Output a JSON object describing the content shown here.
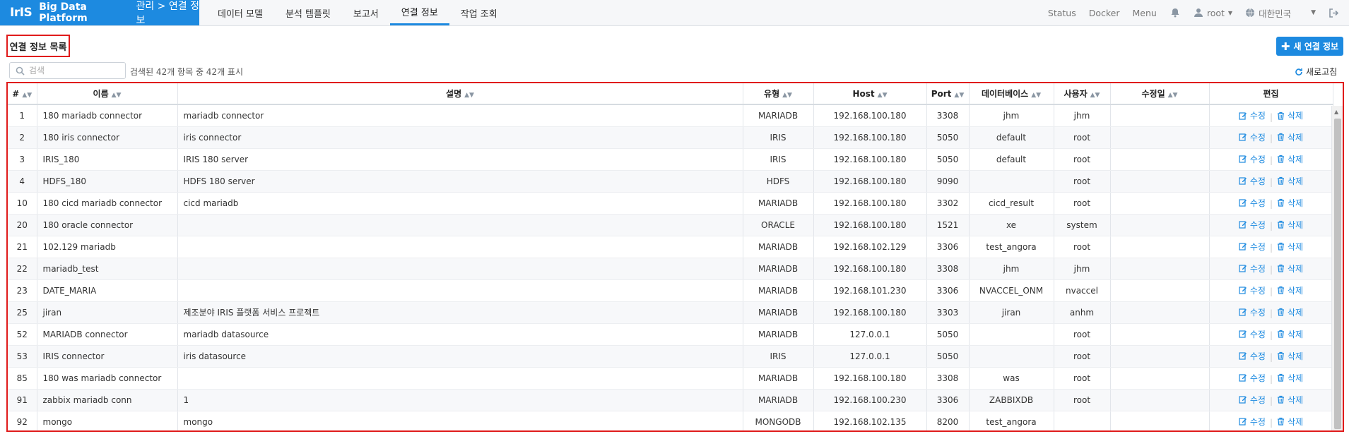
{
  "brand": {
    "logo": "IrIS",
    "name": "Big Data Platform",
    "breadcrumb": "관리 > 연결 정보",
    "color": "#1d8ae0"
  },
  "nav": {
    "items": [
      "데이터 모델",
      "분석 템플릿",
      "보고서",
      "연결 정보",
      "작업 조회"
    ],
    "active": "연결 정보"
  },
  "nav_right": {
    "status": "Status",
    "docker": "Docker",
    "menu": "Menu",
    "user": "root",
    "language": "대한민국"
  },
  "page": {
    "title": "연결 정보 목록",
    "new_button": "새 연결 정보",
    "search_placeholder": "검색",
    "count_text": "검색된 42개 항목 중 42개 표시",
    "refresh": "새로고침"
  },
  "table": {
    "columns": [
      "#",
      "이름",
      "설명",
      "유형",
      "Host",
      "Port",
      "데이터베이스",
      "사용자",
      "수정일",
      "편집"
    ],
    "edit_label": "수정",
    "delete_label": "삭제",
    "rows": [
      {
        "id": "1",
        "name": "180 mariadb connector",
        "desc": "mariadb connector",
        "type": "MARIADB",
        "host": "192.168.100.180",
        "port": "3308",
        "db": "jhm",
        "user": "jhm",
        "date": ""
      },
      {
        "id": "2",
        "name": "180 iris connector",
        "desc": "iris connector",
        "type": "IRIS",
        "host": "192.168.100.180",
        "port": "5050",
        "db": "default",
        "user": "root",
        "date": ""
      },
      {
        "id": "3",
        "name": "IRIS_180",
        "desc": "IRIS 180 server",
        "type": "IRIS",
        "host": "192.168.100.180",
        "port": "5050",
        "db": "default",
        "user": "root",
        "date": ""
      },
      {
        "id": "4",
        "name": "HDFS_180",
        "desc": "HDFS 180 server",
        "type": "HDFS",
        "host": "192.168.100.180",
        "port": "9090",
        "db": "",
        "user": "root",
        "date": ""
      },
      {
        "id": "10",
        "name": "180 cicd mariadb connector",
        "desc": "cicd mariadb",
        "type": "MARIADB",
        "host": "192.168.100.180",
        "port": "3302",
        "db": "cicd_result",
        "user": "root",
        "date": ""
      },
      {
        "id": "20",
        "name": "180 oracle connector",
        "desc": "",
        "type": "ORACLE",
        "host": "192.168.100.180",
        "port": "1521",
        "db": "xe",
        "user": "system",
        "date": ""
      },
      {
        "id": "21",
        "name": "102.129 mariadb",
        "desc": "",
        "type": "MARIADB",
        "host": "192.168.102.129",
        "port": "3306",
        "db": "test_angora",
        "user": "root",
        "date": ""
      },
      {
        "id": "22",
        "name": "mariadb_test",
        "desc": "",
        "type": "MARIADB",
        "host": "192.168.100.180",
        "port": "3308",
        "db": "jhm",
        "user": "jhm",
        "date": ""
      },
      {
        "id": "23",
        "name": "DATE_MARIA",
        "desc": "",
        "type": "MARIADB",
        "host": "192.168.101.230",
        "port": "3306",
        "db": "NVACCEL_ONM",
        "user": "nvaccel",
        "date": ""
      },
      {
        "id": "25",
        "name": "jiran",
        "desc": "제조분야 IRIS 플랫폼 서비스 프로젝트",
        "type": "MARIADB",
        "host": "192.168.100.180",
        "port": "3303",
        "db": "jiran",
        "user": "anhm",
        "date": ""
      },
      {
        "id": "52",
        "name": "MARIADB connector",
        "desc": "mariadb datasource",
        "type": "MARIADB",
        "host": "127.0.0.1",
        "port": "5050",
        "db": "",
        "user": "root",
        "date": ""
      },
      {
        "id": "53",
        "name": "IRIS connector",
        "desc": "iris datasource",
        "type": "IRIS",
        "host": "127.0.0.1",
        "port": "5050",
        "db": "",
        "user": "root",
        "date": ""
      },
      {
        "id": "85",
        "name": "180 was mariadb connector",
        "desc": "",
        "type": "MARIADB",
        "host": "192.168.100.180",
        "port": "3308",
        "db": "was",
        "user": "root",
        "date": ""
      },
      {
        "id": "91",
        "name": "zabbix mariadb conn",
        "desc": "1",
        "type": "MARIADB",
        "host": "192.168.100.230",
        "port": "3306",
        "db": "ZABBIXDB",
        "user": "root",
        "date": ""
      },
      {
        "id": "92",
        "name": "mongo",
        "desc": "mongo",
        "type": "MONGODB",
        "host": "192.168.102.135",
        "port": "8200",
        "db": "test_angora",
        "user": "",
        "date": ""
      }
    ]
  }
}
